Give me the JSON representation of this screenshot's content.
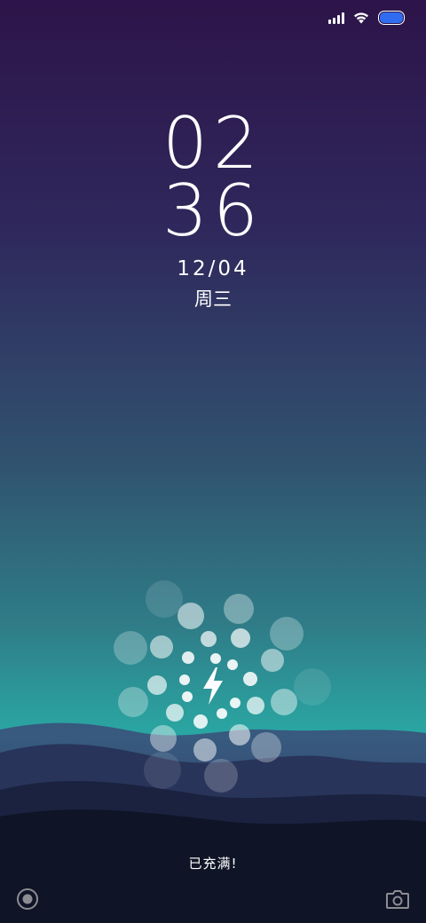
{
  "status_bar": {
    "icons": [
      "signal-icon",
      "wifi-icon",
      "battery-icon"
    ],
    "battery_color": "#2f6cf0"
  },
  "lock": {
    "hour": "02",
    "minute": "36",
    "date": "12/04",
    "weekday": "周三"
  },
  "charging": {
    "status": "已充满!",
    "icon": "lightning-bolt-icon",
    "level": 1.0
  },
  "bottom": {
    "left_icon": "assistant-circle-icon",
    "right_icon": "camera-icon"
  }
}
